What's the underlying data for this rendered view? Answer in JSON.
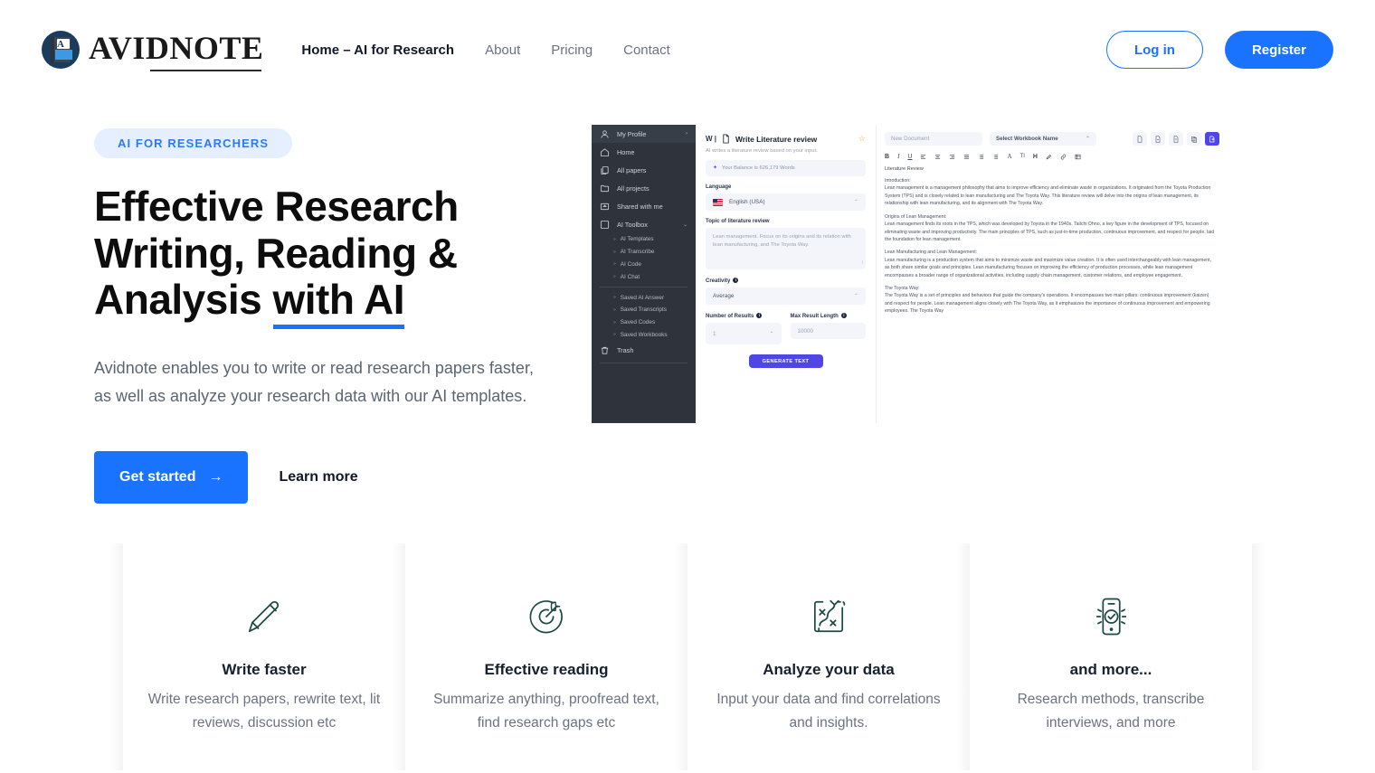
{
  "brand": {
    "name": "AVIDNOTE",
    "logo_letter": "A"
  },
  "nav": {
    "items": [
      {
        "label": "Home – AI for Research",
        "active": true
      },
      {
        "label": "About",
        "active": false
      },
      {
        "label": "Pricing",
        "active": false
      },
      {
        "label": "Contact",
        "active": false
      }
    ],
    "login_label": "Log in",
    "register_label": "Register"
  },
  "hero": {
    "pill": "AI FOR RESEARCHERS",
    "title_line1": "Effective Research",
    "title_line2": "Writing, Reading &",
    "title_line3_plain": "Analysis ",
    "title_line3_highlight": "with AI",
    "subtitle": "Avidnote enables you to write or read research papers faster, as well as analyze your research data with our AI templates.",
    "cta_primary": "Get started",
    "cta_primary_arrow": "→",
    "cta_secondary": "Learn more"
  },
  "app_preview": {
    "sidebar": {
      "top_item": {
        "label": "My Profile",
        "icon": "user-icon",
        "caret": "›"
      },
      "items": [
        {
          "label": "Home",
          "icon": "home-icon"
        },
        {
          "label": "All papers",
          "icon": "papers-icon"
        },
        {
          "label": "All projects",
          "icon": "folder-icon"
        },
        {
          "label": "Shared with me",
          "icon": "shared-icon"
        }
      ],
      "toolbox": {
        "label": "AI Toolbox",
        "icon": "ai-icon",
        "caret": "⌄"
      },
      "toolbox_group1": [
        "AI Templates",
        "AI Transcribe",
        "AI Code",
        "AI Chat"
      ],
      "toolbox_group2": [
        "Saved AI Answer",
        "Saved Transcripts",
        "Saved Codes",
        "Saved Workbooks"
      ],
      "trash": {
        "label": "Trash",
        "icon": "trash-icon"
      }
    },
    "form": {
      "prefix": "W |",
      "title": "Write Literature review",
      "description": "AI writes a literature review based on your input.",
      "balance": "Your Balance is 626,179 Words",
      "language_label": "Language",
      "language_value": "English (USA)",
      "topic_label": "Topic of literature review",
      "topic_value": "Lean management. Focus on its origins and its relation with lean manufacturing, and The Toyota Way.",
      "creativity_label": "Creativity",
      "creativity_value": "Average",
      "results_label": "Number of Results",
      "results_value": "1",
      "maxlen_label": "Max Result Length",
      "maxlen_value": "10000",
      "generate_label": "GENERATE TEXT"
    },
    "editor": {
      "doc_name_placeholder": "New Document",
      "workbook_select": "Select Workbook Name",
      "toolbar": [
        "B",
        "I",
        "U",
        "align-left",
        "align-center",
        "align-right",
        "justify",
        "ordered-list",
        "bullet-list",
        "A",
        "TI",
        "H",
        "highlighter",
        "link",
        "table"
      ],
      "document": {
        "title": "Literature Review",
        "sections": [
          {
            "heading": "Introduction:",
            "body": "Lean management is a management philosophy that aims to improve efficiency and eliminate waste in organizations. It originated from the Toyota Production System (TPS) and is closely related to lean manufacturing and The Toyota Way. This literature review will delve into the origins of lean management, its relationship with lean manufacturing, and its alignment with The Toyota Way."
          },
          {
            "heading": "Origins of Lean Management:",
            "body": "Lean management finds its roots in the TPS, which was developed by Toyota in the 1940s. Taiichi Ohno, a key figure in the development of TPS, focused on eliminating waste and improving productivity. The main principles of TPS, such as just-in-time production, continuous improvement, and respect for people, laid the foundation for lean management."
          },
          {
            "heading": "Lean Manufacturing and Lean Management:",
            "body": "Lean manufacturing is a production system that aims to minimize waste and maximize value creation. It is often used interchangeably with lean management, as both share similar goals and principles. Lean manufacturing focuses on improving the efficiency of production processes, while lean management encompasses a broader range of organizational activities, including supply chain management, customer relations, and employee engagement."
          },
          {
            "heading": "The Toyota Way:",
            "body": "The Toyota Way is a set of principles and behaviors that guide the company's operations. It encompasses two main pillars: continuous improvement (kaizen) and respect for people. Lean management aligns closely with The Toyota Way, as it emphasizes the importance of continuous improvement and empowering employees. The Toyota Way"
          }
        ]
      }
    }
  },
  "features": [
    {
      "icon": "pencil-icon",
      "title": "Write faster",
      "text": "Write research papers, rewrite text, lit reviews, discussion etc"
    },
    {
      "icon": "target-icon",
      "title": "Effective reading",
      "text": "Summarize anything, proofread text, find research gaps etc"
    },
    {
      "icon": "data-analysis-icon",
      "title": "Analyze your data",
      "text": "Input your data and find correlations and insights."
    },
    {
      "icon": "mobile-check-icon",
      "title": "and more...",
      "text": "Research methods, transcribe interviews, and more"
    }
  ],
  "colors": {
    "accent_blue": "#1a73ff",
    "pill_bg": "#e5efff",
    "icon_teal": "#1d4845",
    "sidebar_dark": "#2e333c",
    "purple": "#5046e5"
  }
}
